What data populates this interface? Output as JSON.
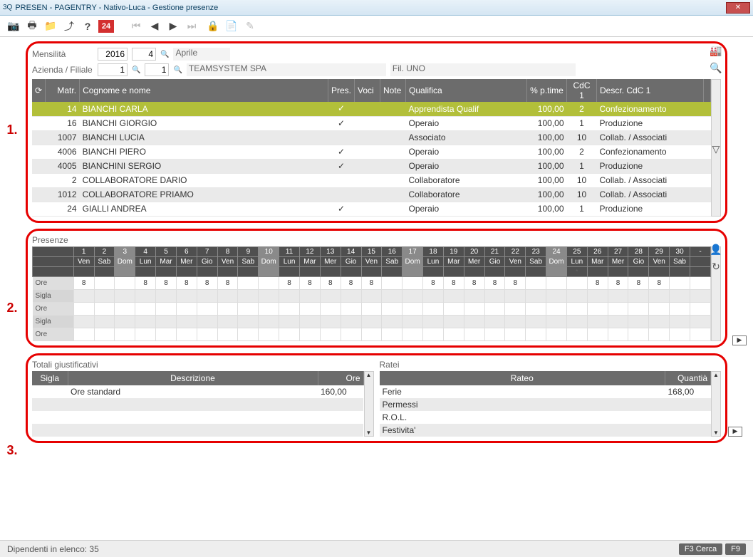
{
  "window": {
    "title": "PRESEN - PAGENTRY - Nativo-Luca - Gestione presenze",
    "icon": "3Q"
  },
  "toolbar": {
    "badge": "24"
  },
  "annotations": [
    "1.",
    "2.",
    "3."
  ],
  "filters": {
    "mensilita_label": "Mensilità",
    "year": "2016",
    "month_num": "4",
    "month_name": "Aprile",
    "azienda_label": "Azienda / Filiale",
    "azienda": "1",
    "filiale": "1",
    "company": "TEAMSYSTEM SPA",
    "branch": "Fil. UNO"
  },
  "emp_headers": {
    "refresh": "⟳",
    "matr": "Matr.",
    "nome": "Cognome e nome",
    "pres": "Pres.",
    "voci": "Voci",
    "note": "Note",
    "qualifica": "Qualifica",
    "ptime": "% p.time",
    "cdc": "CdC 1",
    "descr": "Descr. CdC 1"
  },
  "employees": [
    {
      "matr": "14",
      "nome": "BIANCHI CARLA",
      "pres": true,
      "qual": "Apprendista Qualif",
      "pt": "100,00",
      "cdc": "2",
      "dcdc": "Confezionamento",
      "sel": true
    },
    {
      "matr": "16",
      "nome": "BIANCHI GIORGIO",
      "pres": true,
      "qual": "Operaio",
      "pt": "100,00",
      "cdc": "1",
      "dcdc": "Produzione"
    },
    {
      "matr": "1007",
      "nome": "BIANCHI LUCIA",
      "pres": false,
      "qual": "Associato",
      "pt": "100,00",
      "cdc": "10",
      "dcdc": "Collab. / Associati"
    },
    {
      "matr": "4006",
      "nome": "BIANCHI PIERO",
      "pres": true,
      "qual": "Operaio",
      "pt": "100,00",
      "cdc": "2",
      "dcdc": "Confezionamento"
    },
    {
      "matr": "4005",
      "nome": "BIANCHINI SERGIO",
      "pres": true,
      "qual": "Operaio",
      "pt": "100,00",
      "cdc": "1",
      "dcdc": "Produzione"
    },
    {
      "matr": "2",
      "nome": "COLLABORATORE DARIO",
      "pres": false,
      "qual": "Collaboratore",
      "pt": "100,00",
      "cdc": "10",
      "dcdc": "Collab. / Associati"
    },
    {
      "matr": "1012",
      "nome": "COLLABORATORE PRIAMO",
      "pres": false,
      "qual": "Collaboratore",
      "pt": "100,00",
      "cdc": "10",
      "dcdc": "Collab. / Associati"
    },
    {
      "matr": "24",
      "nome": "GIALLI ANDREA",
      "pres": true,
      "qual": "Operaio",
      "pt": "100,00",
      "cdc": "1",
      "dcdc": "Produzione"
    }
  ],
  "presenze": {
    "title": "Presenze",
    "days": [
      {
        "n": "1",
        "w": "Ven"
      },
      {
        "n": "2",
        "w": "Sab"
      },
      {
        "n": "3",
        "w": "Dom",
        "h": true
      },
      {
        "n": "4",
        "w": "Lun"
      },
      {
        "n": "5",
        "w": "Mar"
      },
      {
        "n": "6",
        "w": "Mer"
      },
      {
        "n": "7",
        "w": "Gio"
      },
      {
        "n": "8",
        "w": "Ven"
      },
      {
        "n": "9",
        "w": "Sab"
      },
      {
        "n": "10",
        "w": "Dom",
        "h": true
      },
      {
        "n": "11",
        "w": "Lun"
      },
      {
        "n": "12",
        "w": "Mar"
      },
      {
        "n": "13",
        "w": "Mer"
      },
      {
        "n": "14",
        "w": "Gio"
      },
      {
        "n": "15",
        "w": "Ven"
      },
      {
        "n": "16",
        "w": "Sab"
      },
      {
        "n": "17",
        "w": "Dom",
        "h": true
      },
      {
        "n": "18",
        "w": "Lun"
      },
      {
        "n": "19",
        "w": "Mar"
      },
      {
        "n": "20",
        "w": "Mer"
      },
      {
        "n": "21",
        "w": "Gio"
      },
      {
        "n": "22",
        "w": "Ven"
      },
      {
        "n": "23",
        "w": "Sab"
      },
      {
        "n": "24",
        "w": "Dom",
        "h": true
      },
      {
        "n": "25",
        "w": "Lun",
        "star": true
      },
      {
        "n": "26",
        "w": "Mar"
      },
      {
        "n": "27",
        "w": "Mer"
      },
      {
        "n": "28",
        "w": "Gio"
      },
      {
        "n": "29",
        "w": "Ven"
      },
      {
        "n": "30",
        "w": "Sab"
      },
      {
        "n": "-",
        "w": ""
      }
    ],
    "row_labels": [
      "Ore",
      "Sigla",
      "Ore",
      "Sigla",
      "Ore"
    ],
    "ore": [
      "8",
      "",
      "",
      "8",
      "8",
      "8",
      "8",
      "8",
      "",
      "",
      "8",
      "8",
      "8",
      "8",
      "8",
      "",
      "",
      "8",
      "8",
      "8",
      "8",
      "8",
      "",
      "",
      "",
      "8",
      "8",
      "8",
      "8",
      "",
      ""
    ]
  },
  "totali": {
    "title": "Totali giustificativi",
    "headers": {
      "sigla": "Sigla",
      "descr": "Descrizione",
      "ore": "Ore"
    },
    "rows": [
      {
        "sigla": "",
        "descr": "Ore standard",
        "ore": "160,00"
      }
    ]
  },
  "ratei": {
    "title": "Ratei",
    "headers": {
      "rateo": "Rateo",
      "qta": "Quantià"
    },
    "rows": [
      {
        "r": "Ferie",
        "q": "168,00"
      },
      {
        "r": "Permessi",
        "q": ""
      },
      {
        "r": "R.O.L.",
        "q": ""
      },
      {
        "r": "Festivita'",
        "q": ""
      }
    ]
  },
  "status": {
    "count": "Dipendenti in elenco: 35",
    "f3": "F3 Cerca",
    "f9": "F9"
  }
}
